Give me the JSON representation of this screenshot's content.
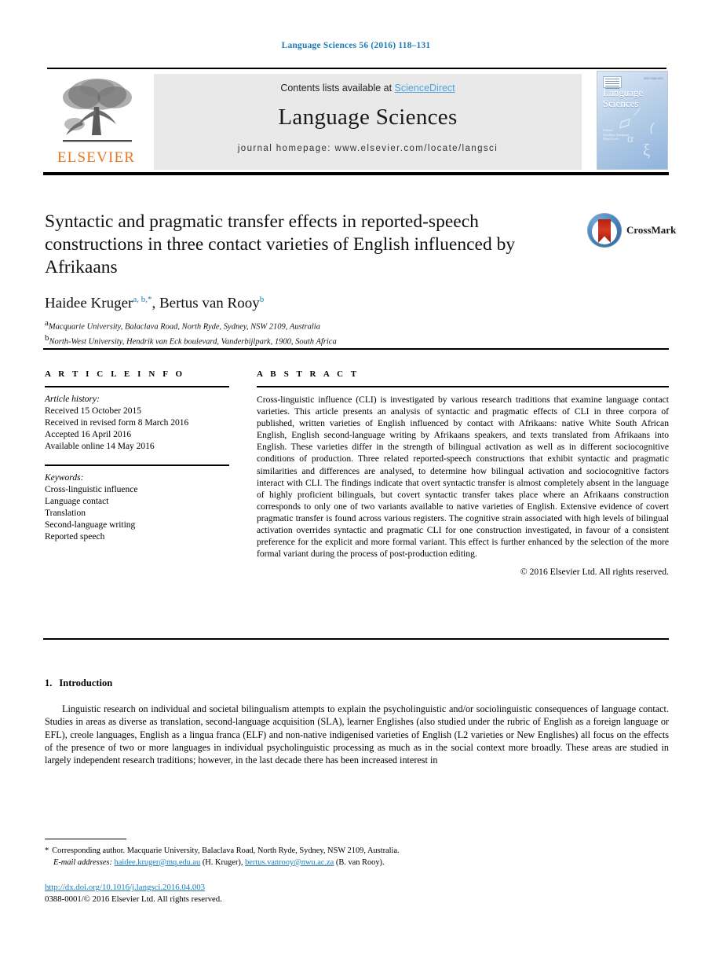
{
  "running_head": "Language Sciences 56 (2016) 118–131",
  "masthead": {
    "contents_prefix": "Contents lists available at ",
    "sciencedirect": "ScienceDirect",
    "journal_title": "Language Sciences",
    "homepage": "journal homepage: www.elsevier.com/locate/langsci",
    "publisher_name": "ELSEVIER",
    "cover": {
      "title_line1": "Language",
      "title_line2": "Sciences",
      "editor_note": "Editors\nGeoffrey Sampson,\nNigel Love",
      "top_note": "ISSN 0388-0001",
      "glyphs": [
        "α",
        "ξ"
      ]
    }
  },
  "article": {
    "title": "Syntactic and pragmatic transfer effects in reported-speech constructions in three contact varieties of English influenced by Afrikaans",
    "authors_plain": "Haidee Kruger",
    "author1_sup": "a, b,",
    "author1_star": "*",
    "authors_sep": ", ",
    "author2": "Bertus van Rooy",
    "author2_sup": "b",
    "affiliations": [
      {
        "mark": "a",
        "text": "Macquarie University, Balaclava Road, North Ryde, Sydney, NSW 2109, Australia"
      },
      {
        "mark": "b",
        "text": "North-West University, Hendrik van Eck boulevard, Vanderbijlpark, 1900, South Africa"
      }
    ],
    "crossmark_label": "CrossMark"
  },
  "article_info": {
    "heading": "A R T I C L E   I N F O",
    "history_label": "Article history:",
    "history": [
      "Received 15 October 2015",
      "Received in revised form 8 March 2016",
      "Accepted 16 April 2016",
      "Available online 14 May 2016"
    ],
    "keywords_label": "Keywords:",
    "keywords": [
      "Cross-linguistic influence",
      "Language contact",
      "Translation",
      "Second-language writing",
      "Reported speech"
    ]
  },
  "abstract": {
    "heading": "A B S T R A C T",
    "text": "Cross-linguistic influence (CLI) is investigated by various research traditions that examine language contact varieties. This article presents an analysis of syntactic and pragmatic effects of CLI in three corpora of published, written varieties of English influenced by contact with Afrikaans: native White South African English, English second-language writing by Afrikaans speakers, and texts translated from Afrikaans into English. These varieties differ in the strength of bilingual activation as well as in different sociocognitive conditions of production. Three related reported-speech constructions that exhibit syntactic and pragmatic similarities and differences are analysed, to determine how bilingual activation and sociocognitive factors interact with CLI. The findings indicate that overt syntactic transfer is almost completely absent in the language of highly proficient bilinguals, but covert syntactic transfer takes place where an Afrikaans construction corresponds to only one of two variants available to native varieties of English. Extensive evidence of covert pragmatic transfer is found across various registers. The cognitive strain associated with high levels of bilingual activation overrides syntactic and pragmatic CLI for one construction investigated, in favour of a consistent preference for the explicit and more formal variant. This effect is further enhanced by the selection of the more formal variant during the process of post-production editing.",
    "copyright": "© 2016 Elsevier Ltd. All rights reserved."
  },
  "body": {
    "section_number": "1.",
    "section_title": "Introduction",
    "paragraph": "Linguistic research on individual and societal bilingualism attempts to explain the psycholinguistic and/or sociolinguistic consequences of language contact. Studies in areas as diverse as translation, second-language acquisition (SLA), learner Englishes (also studied under the rubric of English as a foreign language or EFL), creole languages, English as a lingua franca (ELF) and non-native indigenised varieties of English (L2 varieties or New Englishes) all focus on the effects of the presence of two or more languages in individual psycholinguistic processing as much as in the social context more broadly. These areas are studied in largely independent research traditions; however, in the last decade there has been increased interest in"
  },
  "footer": {
    "star": "*",
    "corresponding": "Corresponding author. Macquarie University, Balaclava Road, North Ryde, Sydney, NSW 2109, Australia.",
    "email_label": "E-mail addresses:",
    "email1": "haidee.kruger@mq.edu.au",
    "email1_owner": "(H. Kruger)",
    "email_sep": ", ",
    "email2": "bertus.vanrooy@nwu.ac.za",
    "email2_owner": "(B. van Rooy).",
    "doi": "http://dx.doi.org/10.1016/j.langsci.2016.04.003",
    "issn_line": "0388-0001/© 2016 Elsevier Ltd. All rights reserved."
  },
  "colors": {
    "link": "#1a7cb5",
    "sciencedirect": "#4ea3d8",
    "elsevier_orange": "#E87722",
    "band_gray": "#e9e9e9"
  }
}
